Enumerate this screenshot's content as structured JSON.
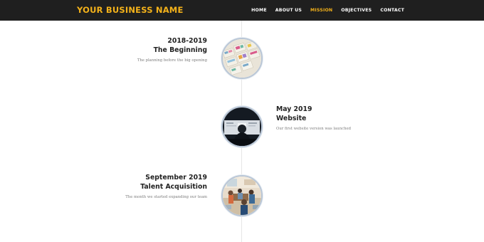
{
  "header": {
    "brand": "YOUR BUSINESS NAME",
    "nav": [
      "HOME",
      "ABOUT US",
      "MISSION",
      "OBJECTIVES",
      "CONTACT"
    ],
    "active_nav": "MISSION"
  },
  "timeline": [
    {
      "date": "2018-2019",
      "title": "The Beginning",
      "description": "The planning before the big opening",
      "image": "planning-documents-photo",
      "side": "left"
    },
    {
      "date": "May 2019",
      "title": "Website",
      "description": "Our first website version was launched",
      "image": "computer-screen-photo",
      "side": "right"
    },
    {
      "date": "September 2019",
      "title": "Talent Acquisition",
      "description": "The month we started expanding our team",
      "image": "team-office-photo",
      "side": "left"
    }
  ],
  "colors": {
    "accent": "#f4b21a",
    "header_bg": "#1f1f1f",
    "circle_border": "#b9c6d6"
  }
}
